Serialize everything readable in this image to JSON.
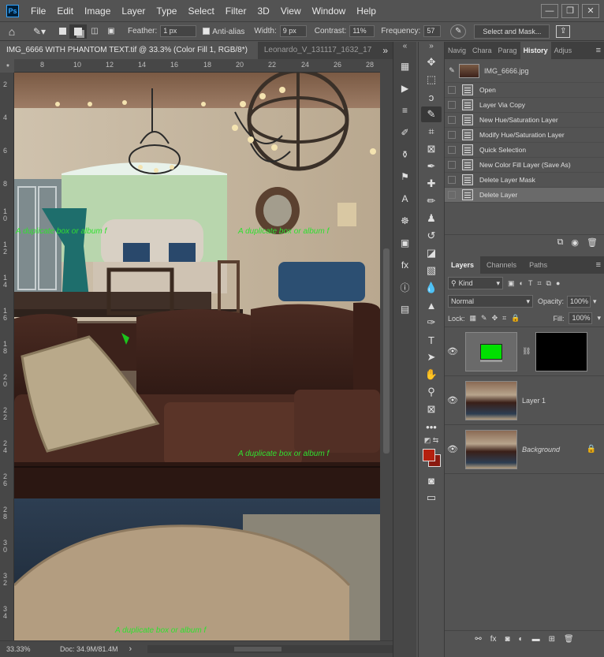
{
  "app": {
    "logo_text": "Ps"
  },
  "menu": {
    "items": [
      "File",
      "Edit",
      "Image",
      "Layer",
      "Type",
      "Select",
      "Filter",
      "3D",
      "View",
      "Window",
      "Help"
    ]
  },
  "window_controls": {
    "minimize": "—",
    "restore": "❐",
    "close": "✕"
  },
  "options": {
    "feather_label": "Feather:",
    "feather_value": "1 px",
    "antialias_label": "Anti-alias",
    "width_label": "Width:",
    "width_value": "9 px",
    "contrast_label": "Contrast:",
    "contrast_value": "11%",
    "frequency_label": "Frequency:",
    "frequency_value": "57",
    "select_mask_label": "Select and Mask..."
  },
  "tabs": {
    "active": "IMG_6666 WITH PHANTOM TEXT.tif @ 33.3% (Color Fill 1, RGB/8*) *",
    "active_close": "×",
    "inactive": "Leonardo_V_131117_1632_17",
    "overflow": "»"
  },
  "ruler": {
    "top": [
      "8",
      "10",
      "12",
      "14",
      "16",
      "18",
      "20",
      "22",
      "24",
      "26",
      "28"
    ],
    "left": [
      "2",
      "4",
      "6",
      "8",
      "1\n0",
      "1\n2",
      "1\n4",
      "1\n6",
      "1\n8",
      "2\n0",
      "2\n2",
      "2\n4",
      "2\n6",
      "2\n8",
      "3\n0",
      "3\n2",
      "3\n4"
    ]
  },
  "canvas": {
    "phantom_texts": [
      "A duplicate box or album f",
      "A duplicate box or album f",
      "A duplicate box or album f",
      "A duplicate box or album f"
    ]
  },
  "status": {
    "zoom": "33.33%",
    "doc": "Doc: 34.9M/81.4M",
    "arrow": "›"
  },
  "history_panel": {
    "tabs": [
      "Navig",
      "Chara",
      "Parag",
      "History",
      "Adjus"
    ],
    "snapshot_name": "IMG_6666.jpg",
    "steps": [
      "Open",
      "Layer Via Copy",
      "New Hue/Saturation Layer",
      "Modify Hue/Saturation Layer",
      "Quick Selection",
      "New Color Fill Layer (Save As)",
      "Delete Layer Mask",
      "Delete Layer"
    ],
    "selected_step": "Delete Layer"
  },
  "layers_panel": {
    "tabs": [
      "Layers",
      "Channels",
      "Paths"
    ],
    "filter_kind": "Kind",
    "blend_mode": "Normal",
    "opacity_label": "Opacity:",
    "opacity_value": "100%",
    "lock_label": "Lock:",
    "fill_label": "Fill:",
    "fill_value": "100%",
    "layers": [
      {
        "name": "",
        "type": "color-fill",
        "fill_color": "#00e000"
      },
      {
        "name": "Layer 1",
        "type": "pixel"
      },
      {
        "name": "Background",
        "type": "background",
        "locked": true
      }
    ]
  },
  "colors": {
    "foreground": "#b4200f",
    "background": "#8a1a10",
    "accent": "#2fa3ff",
    "phantom_text": "#30e030"
  }
}
